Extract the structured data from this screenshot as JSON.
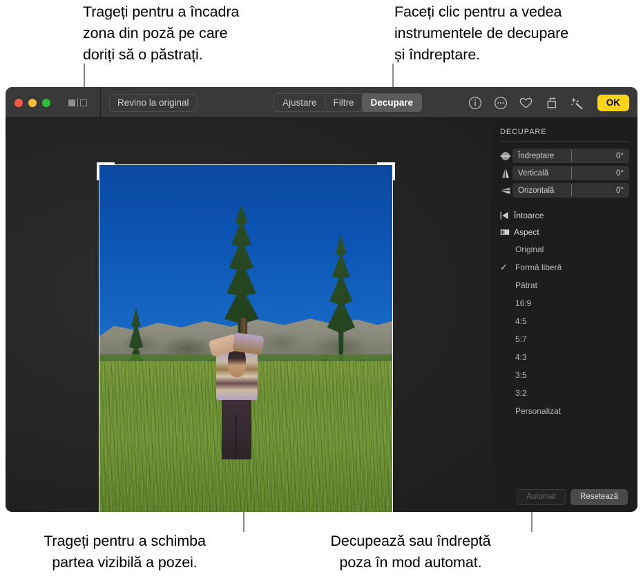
{
  "callouts": {
    "top_left": "Trageți pentru a încadra\nzona din poză pe care\ndoriți să o păstrați.",
    "top_right": "Faceți clic pentru a vedea\ninstrumentele de decupare\nși îndreptare.",
    "bottom_left": "Trageți pentru a schimba\npartea vizibilă a pozei.",
    "bottom_right": "Decupează sau îndreptă\npoza în mod automat."
  },
  "toolbar": {
    "revert_label": "Revino la original",
    "segments": [
      {
        "label": "Ajustare",
        "active": false
      },
      {
        "label": "Filtre",
        "active": false
      },
      {
        "label": "Decupare",
        "active": true
      }
    ],
    "ok_label": "OK",
    "icons": [
      "info-icon",
      "more-options-icon",
      "favorite-heart-icon",
      "rotate-icon",
      "enhance-magic-wand-icon"
    ],
    "window_buttons": [
      "close",
      "minimize",
      "zoom"
    ],
    "sidebar_toggle": "sidebar-toggle-icon"
  },
  "inspector": {
    "title": "DECUPARE",
    "sliders": [
      {
        "icon": "straighten-icon",
        "label": "Îndreptare",
        "value": "0°"
      },
      {
        "icon": "vertical-perspective-icon",
        "label": "Verticală",
        "value": "0°"
      },
      {
        "icon": "horizontal-perspective-icon",
        "label": "Orizontală",
        "value": "0°"
      }
    ],
    "menus": [
      {
        "icon": "flip-icon",
        "label": "Întoarce"
      },
      {
        "icon": "aspect-icon",
        "label": "Aspect"
      }
    ],
    "aspect_items": [
      {
        "label": "Original",
        "selected": false
      },
      {
        "label": "Formă liberă",
        "selected": true
      },
      {
        "label": "Pătrat",
        "selected": false
      },
      {
        "label": "16:9",
        "selected": false
      },
      {
        "label": "4:5",
        "selected": false
      },
      {
        "label": "5:7",
        "selected": false
      },
      {
        "label": "4:3",
        "selected": false
      },
      {
        "label": "3:5",
        "selected": false
      },
      {
        "label": "3:2",
        "selected": false
      },
      {
        "label": "Personalizat",
        "selected": false
      }
    ],
    "checkmark": "✓",
    "footer": {
      "auto_label": "Automat",
      "reset_label": "Resetează"
    }
  },
  "colors": {
    "accent_ok": "#fbd419",
    "window_chrome": "#393939",
    "inspector_bg": "#1d1d1d",
    "canvas_bg": "#262626",
    "crop_handle": "#ffffff"
  }
}
